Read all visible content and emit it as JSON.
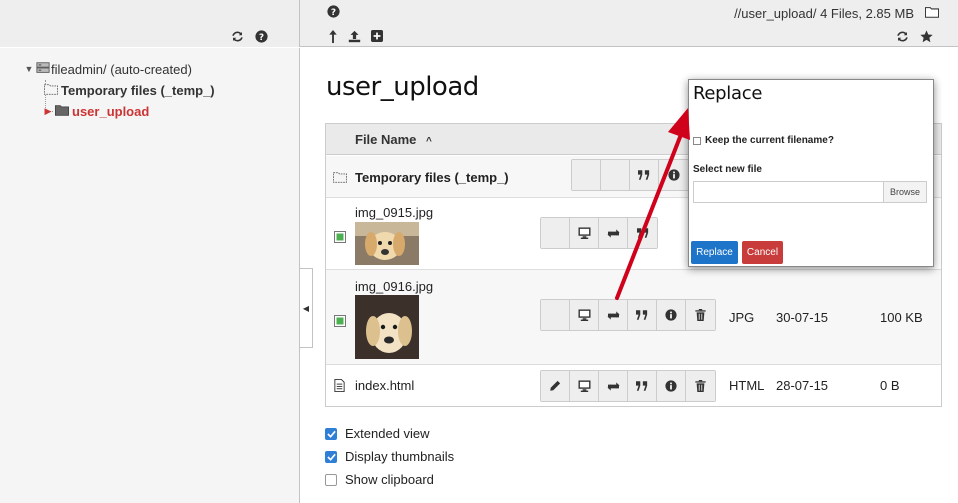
{
  "header": {
    "path_info": "//user_upload/ 4 Files, 2.85 MB",
    "icons": [
      "refresh-icon",
      "help-icon",
      "help-icon",
      "level-up-icon",
      "upload-icon",
      "new-icon",
      "folder-icon",
      "refresh-icon",
      "bookmark-icon"
    ]
  },
  "tree": {
    "root_label": "fileadmin/ (auto-created)",
    "items": [
      {
        "label": "Temporary files (_temp_)"
      },
      {
        "label": "user_upload"
      }
    ],
    "active_color": "#cc3333"
  },
  "main": {
    "title": "user_upload",
    "table": {
      "col_name": "File Name",
      "rows": [
        {
          "name": "Temporary files (_temp_)",
          "type": "",
          "date": "",
          "size": ""
        },
        {
          "name": "img_0915.jpg",
          "type": "",
          "date": "",
          "size": ""
        },
        {
          "name": "img_0916.jpg",
          "type": "JPG",
          "date": "30-07-15",
          "size": "100 KB"
        },
        {
          "name": "index.html",
          "type": "HTML",
          "date": "28-07-15",
          "size": "0 B"
        }
      ]
    },
    "options": [
      {
        "label": "Extended view",
        "checked": true
      },
      {
        "label": "Display thumbnails",
        "checked": true
      },
      {
        "label": "Show clipboard",
        "checked": false
      }
    ]
  },
  "modal": {
    "title": "Replace",
    "keep_label": "Keep the current filename?",
    "select_label": "Select new file",
    "browse_label": "Browse",
    "replace_label": "Replace",
    "cancel_label": "Cancel"
  },
  "colors": {
    "accent_blue": "#1d74c9",
    "danger_red": "#c83c3c",
    "annotation_arrow": "#d0021b"
  }
}
